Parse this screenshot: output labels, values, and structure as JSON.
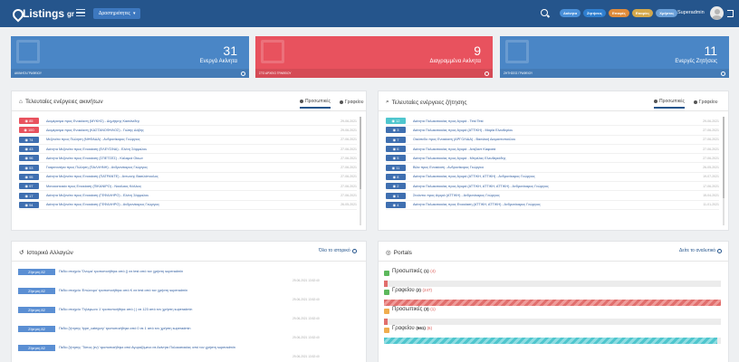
{
  "header": {
    "logo": "Listings",
    "logo_suffix": "gr",
    "dropdown_label": "Δραστηριότητες",
    "pills": [
      {
        "label": "Ακίνητα",
        "color": "#4a90d9"
      },
      {
        "label": "Ζητήσεις",
        "color": "#2f7fd0"
      },
      {
        "label": "Επαφές",
        "color": "#e08b3a"
      },
      {
        "label": "Εταιρίες",
        "color": "#d4a84b"
      },
      {
        "label": "Χρήστες",
        "color": "#6a9fd8"
      }
    ],
    "user": "Superadmin"
  },
  "stats": [
    {
      "number": "31",
      "label": "Ενεργά Ακίνητα",
      "footer": "ΑΚΙΝΗΤΑ ΓΡΑΦΕΙΟΥ",
      "color": "#4a86c6"
    },
    {
      "number": "9",
      "label": "Διαγραμμένα Ακίνητα",
      "footer": "ΣΤΟ ΑΡΧΕΙΟ ΓΡΑΦΕΙΟΥ",
      "color": "#e8525e"
    },
    {
      "number": "11",
      "label": "Ενεργές Ζητήσεις",
      "footer": "ΖΗΤΗΣΕΙΣ ΓΡΑΦΕΙΟΥ",
      "color": "#4a86c6"
    }
  ],
  "properties_panel": {
    "title": "Τελευταίες ενέργειες ακινήτων",
    "tabs": [
      "Προσωπικές",
      "Γραφείου"
    ],
    "rows": [
      {
        "id": "85",
        "color": "#e8525e",
        "text": "Διαμέρισμα προς Ενοικίαση (ΜΥΚΗΣ) - Δημήτρης Κασιάνιδης",
        "date": "29-06-2021"
      },
      {
        "id": "100",
        "color": "#e8525e",
        "text": "Διαμέρισμα προς Ενοικίαση (ΚΑΣΤΑΝΟΦΗΛΟΣ) - Γιώτης Δάβης",
        "date": "29-06-2021"
      },
      {
        "id": "74",
        "color": "#3f6fb0",
        "text": "Μεζονέτα προς Πώληση (ΝΗΦΑΔΑ) - Ανδρονίκαρος Γεώργιος",
        "date": "27-06-2021"
      },
      {
        "id": "43",
        "color": "#3f6fb0",
        "text": "Ακίνητα Μεζονέτα προς Ενοικίαση (ΕΛΕΥΣΙΝΑ) - Ελένη Σάρμαλου",
        "date": "27-06-2021"
      },
      {
        "id": "96",
        "color": "#3f6fb0",
        "text": "Ακίνητα Μεζονέτα προς Ενοικίαση (ΣΠΕΤΣΕΣ) - Καλαμιά Οίκων",
        "date": "27-06-2021"
      },
      {
        "id": "53",
        "color": "#3f6fb0",
        "text": "Γκαρσονιέρα προς Πώληση (ΠΑΛΛΗΝΗ) - Ανδρονίκαρος Γεώργιος",
        "date": "27-06-2021"
      },
      {
        "id": "95",
        "color": "#3f6fb0",
        "text": "Ακίνητα Μεζονέτα προς Ενοικίαση (ΠΑΤΡΑΝΤΕ) - Αντωνης Βασιλόπουλος",
        "date": "27-06-2021"
      },
      {
        "id": "97",
        "color": "#3f6fb0",
        "text": "Μονοκατοικία προς Ενοικίαση (ΠΙΚΑΝΙΡΟ) - Νικόλαος Κάλλιος",
        "date": "27-06-2021"
      },
      {
        "id": "17",
        "color": "#3f6fb0",
        "text": "Ακίνητα Μεζονέτα προς Ενοικίαση (ΓΕΦΑΛΗΡΟ) - Ελένη Σάρμαλου",
        "date": "27-06-2021"
      },
      {
        "id": "94",
        "color": "#3f6fb0",
        "text": "Ακίνητα Μεζονέτα προς Ενοικίαση (ΓΕΦΑΛΗΡΟ) - Ανδρονίκαρος Γεώργιος",
        "date": "26-05-2021"
      }
    ]
  },
  "requests_panel": {
    "title": "Τελευταίες ενέργειες ζήτησης",
    "tabs": [
      "Προσωπικές",
      "Γραφείου"
    ],
    "rows": [
      {
        "id": "12",
        "color": "#4fc6ce",
        "text": "Ακίνητα Πολυκατοικίας προς Αγορά - Test Test",
        "date": "29-06-2021"
      },
      {
        "id": "3",
        "color": "#3f6fb0",
        "text": "Ακίνητα Πολυκατοικίας προς Αγορά (ΑΤΤΙΚΗ) - Μαρία Ελευθερίου",
        "date": "27-06-2021"
      },
      {
        "id": "7",
        "color": "#3f6fb0",
        "text": "Οικόπεδο προς Ενοικίαση (ΑΡΓΟΛΙΔΑ) - Βασιλική Διαμαντοπούλου",
        "date": "27-06-2021"
      },
      {
        "id": "6",
        "color": "#3f6fb0",
        "text": "Ακίνητα Πολυκατοικίας προς Αγορά - Ανεβαντ Καφασά",
        "date": "27-06-2021"
      },
      {
        "id": "5",
        "color": "#3f6fb0",
        "text": "Ακίνητα Πολυκατοικίας προς Αγορά - Μπρέλας Ελευθεριάδης",
        "date": "27-06-2021"
      },
      {
        "id": "11",
        "color": "#3f6fb0",
        "text": "Βίλα προς Ενοικίαση - Ανδρονίκαρος Γεώργιος",
        "date": "26-05-2021"
      },
      {
        "id": "8",
        "color": "#3f6fb0",
        "text": "Ακίνητα Πολυκατοικίας προς Αγορά (ΑΤΤΙΚΗ, ΑΤΤΙΚΗ) - Ανδρονίκαρος Γεώργιος",
        "date": "19-07-2021"
      },
      {
        "id": "2",
        "color": "#3f6fb0",
        "text": "Ακίνητα Πολυκατοικίας προς Αγορά (ΑΤΤΙΚΗ, ΑΤΤΙΚΗ, ΑΤΤΙΚΗ) - Ανδρονίκαρος Γεώργιος",
        "date": "17-06-2021"
      },
      {
        "id": "1",
        "color": "#3f6fb0",
        "text": "Στούντιο προς Αγορά (ΑΤΤΙΚΗ) - Ανδρονίκαρος Γεώργιος",
        "date": "15-04-2021"
      },
      {
        "id": "4",
        "color": "#3f6fb0",
        "text": "Ακίνητα Πολυκατοικίας προς Ενοικίαση (ΑΤΤΙΚΗ, ΑΤΤΙΚΗ) - Ανδρονίκαρος Γεώργιος",
        "date": "11-01-2021"
      }
    ]
  },
  "history_panel": {
    "title": "Ιστορικό Αλλαγών",
    "link": "Όλο το ιστορικό",
    "items": [
      {
        "badge": "Ζήτηση 82",
        "text": "Πεδίο στοιχείο 'Όνομα' τροποποιήθηκε από () σε test από τον χρήστη superadmin",
        "date": "29-06-2021 13:52:40"
      },
      {
        "badge": "Ζήτηση 82",
        "text": "Πεδίο στοιχείο 'Επώνυμο' τροποποιήθηκε από Κ σε test από τον χρήστη superadmin",
        "date": "29-06-2021 13:52:40"
      },
      {
        "badge": "Ζήτηση 82",
        "text": "Πεδίο στοιχείο 'Τηλέφωνο 1' τροποποιήθηκε από ( ) σε 123 από τον χρήστη superadmin",
        "date": "29-06-2021 13:52:40"
      },
      {
        "badge": "Ζήτηση 82",
        "text": "Πεδίο ζήτησης 'type_category' τροποποιήθηκε από 0 σε 1 από τον χρήστη superadmin",
        "date": "29-06-2021 13:52:40"
      },
      {
        "badge": "Ζήτηση 82",
        "text": "Πεδίο ζήτησης 'Τύπος (εν)' τροποποιήθηκε από Αγοραζόμενο σε Ακίνητα Πολυκατοικίας από τον χρήστη superadmin",
        "date": "29-06-2021 13:52:40"
      }
    ]
  },
  "portals_panel": {
    "title": "Portals",
    "link": "Δείτε το αναλυτικό",
    "items": [
      {
        "label": "Προσωπικές",
        "count": "(1)",
        "sub": "(4)",
        "color": "#5cb85c",
        "fill": 0.01,
        "style": "solid-red"
      },
      {
        "label": "Γραφείου",
        "count": "(2)",
        "sub": "(247)",
        "color": "#5cb85c",
        "fill": 1.0,
        "style": "stripe-red"
      },
      {
        "label": "Προσωπικές",
        "count": "(3)",
        "sub": "(1)",
        "color": "#f0ad4e",
        "fill": 0.01,
        "style": "solid-red"
      },
      {
        "label": "Γραφείου",
        "count": "(661)",
        "sub": "(6)",
        "color": "#f0ad4e",
        "fill": 0.99,
        "style": "stripe-cyan"
      }
    ]
  }
}
